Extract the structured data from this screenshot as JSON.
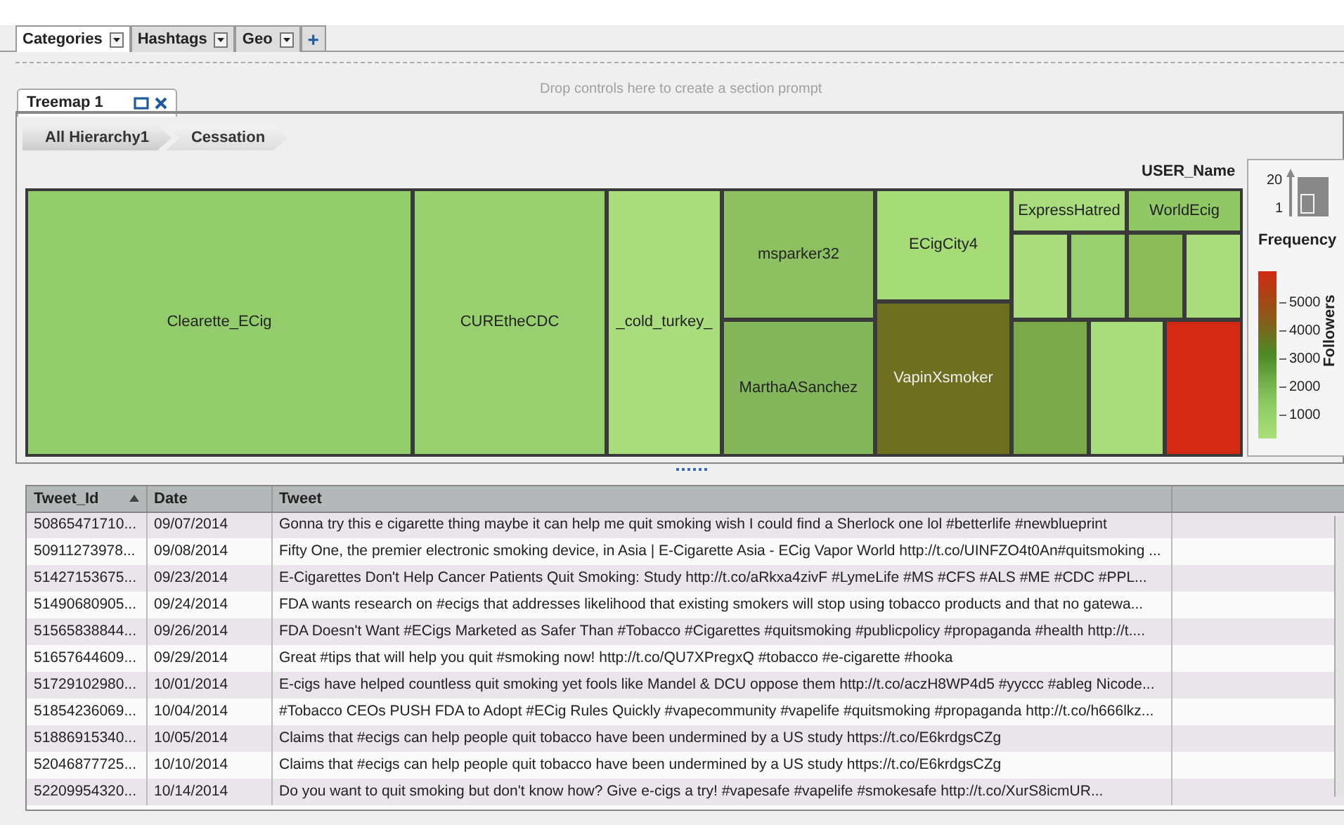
{
  "prompt_tabs": [
    {
      "label": "Categories",
      "selected": true
    },
    {
      "label": "Hashtags",
      "selected": false
    },
    {
      "label": "Geo",
      "selected": false
    }
  ],
  "add_button": "+",
  "drop_zone": "Drop controls here to create a section prompt",
  "section_tab": {
    "title": "Treemap 1"
  },
  "breadcrumbs": [
    "All Hierarchy1",
    "Cessation"
  ],
  "treemap": {
    "title": "USER_Name",
    "tiles": [
      {
        "label": "Clearette_ECig",
        "color": "#93cd6b"
      },
      {
        "label": "CUREtheCDC",
        "color": "#98d070"
      },
      {
        "label": "_cold_turkey_",
        "color": "#a8dc7c"
      },
      {
        "label": "msparker32",
        "color": "#8dc060"
      },
      {
        "label": "MarthaASanchez",
        "color": "#84b75b"
      },
      {
        "label": "ECigCity4",
        "color": "#a5dc78"
      },
      {
        "label": "VapinXsmoker",
        "color": "#6e7020"
      },
      {
        "label": "ExpressHatred",
        "color": "#a8dc7c"
      },
      {
        "label": "WorldEcig",
        "color": "#90c865"
      },
      {
        "color": "#a8dc7c"
      },
      {
        "color": "#98d070"
      },
      {
        "color": "#8cbb5a"
      },
      {
        "color": "#a8dc7c"
      },
      {
        "color": "#7aaa4a"
      },
      {
        "color": "#a8dc7c"
      },
      {
        "color": "#d42a14"
      }
    ]
  },
  "legend": {
    "size_max": "20",
    "size_min": "1",
    "size_title": "Frequency",
    "color_ticks": [
      "5000",
      "4000",
      "3000",
      "2000",
      "1000"
    ],
    "color_title": "Followers"
  },
  "table": {
    "columns": [
      {
        "label": "Tweet_Id",
        "sorted": true
      },
      {
        "label": "Date"
      },
      {
        "label": "Tweet"
      }
    ],
    "rows": [
      [
        "50865471710...",
        "09/07/2014",
        "Gonna try this e cigarette thing maybe it can help me quit smoking wish I could find a Sherlock one lol #betterlife #newblueprint"
      ],
      [
        "50911273978...",
        "09/08/2014",
        "Fifty One, the premier electronic smoking device, in Asia | E-Cigarette Asia - ECig Vapor World http://t.co/UINFZO4t0An#quitsmoking ..."
      ],
      [
        "51427153675...",
        "09/23/2014",
        "E-Cigarettes Don't Help Cancer Patients Quit Smoking: Study http://t.co/aRkxa4zivF #LymeLife #MS #CFS #ALS #ME #CDC #PPL..."
      ],
      [
        "51490680905...",
        "09/24/2014",
        "FDA wants research on #ecigs that addresses likelihood that existing smokers will stop using tobacco products and that no gatewa..."
      ],
      [
        "51565838844...",
        "09/26/2014",
        "FDA Doesn't Want #ECigs Marketed as Safer Than #Tobacco #Cigarettes #quitsmoking #publicpolicy #propaganda #health http://t...."
      ],
      [
        "51657644609...",
        "09/29/2014",
        "Great #tips that will help you quit #smoking now! http://t.co/QU7XPregxQ #tobacco #e-cigarette #hooka"
      ],
      [
        "51729102980...",
        "10/01/2014",
        "E-cigs have helped countless quit  smoking yet fools like Mandel & DCU oppose them http://t.co/aczH8WP4d5 #yyccc #ableg Nicode..."
      ],
      [
        "51854236069...",
        "10/04/2014",
        "#Tobacco CEOs PUSH FDA to Adopt #ECig Rules Quickly #vapecommunity #vapelife #quitsmoking #propaganda http://t.co/h666lkz..."
      ],
      [
        "51886915340...",
        "10/05/2014",
        "Claims that #ecigs can help people quit tobacco have been undermined by a US study https://t.co/E6krdgsCZg"
      ],
      [
        "52046877725...",
        "10/10/2014",
        "Claims that #ecigs can help people quit tobacco have been undermined by a US study https://t.co/E6krdgsCZg"
      ],
      [
        "52209954320...",
        "10/14/2014",
        "Do you want to quit smoking but don't know how? Give e-cigs a try! #vapesafe #vapelife #smokesafe http://t.co/XurS8icmUR..."
      ]
    ]
  }
}
